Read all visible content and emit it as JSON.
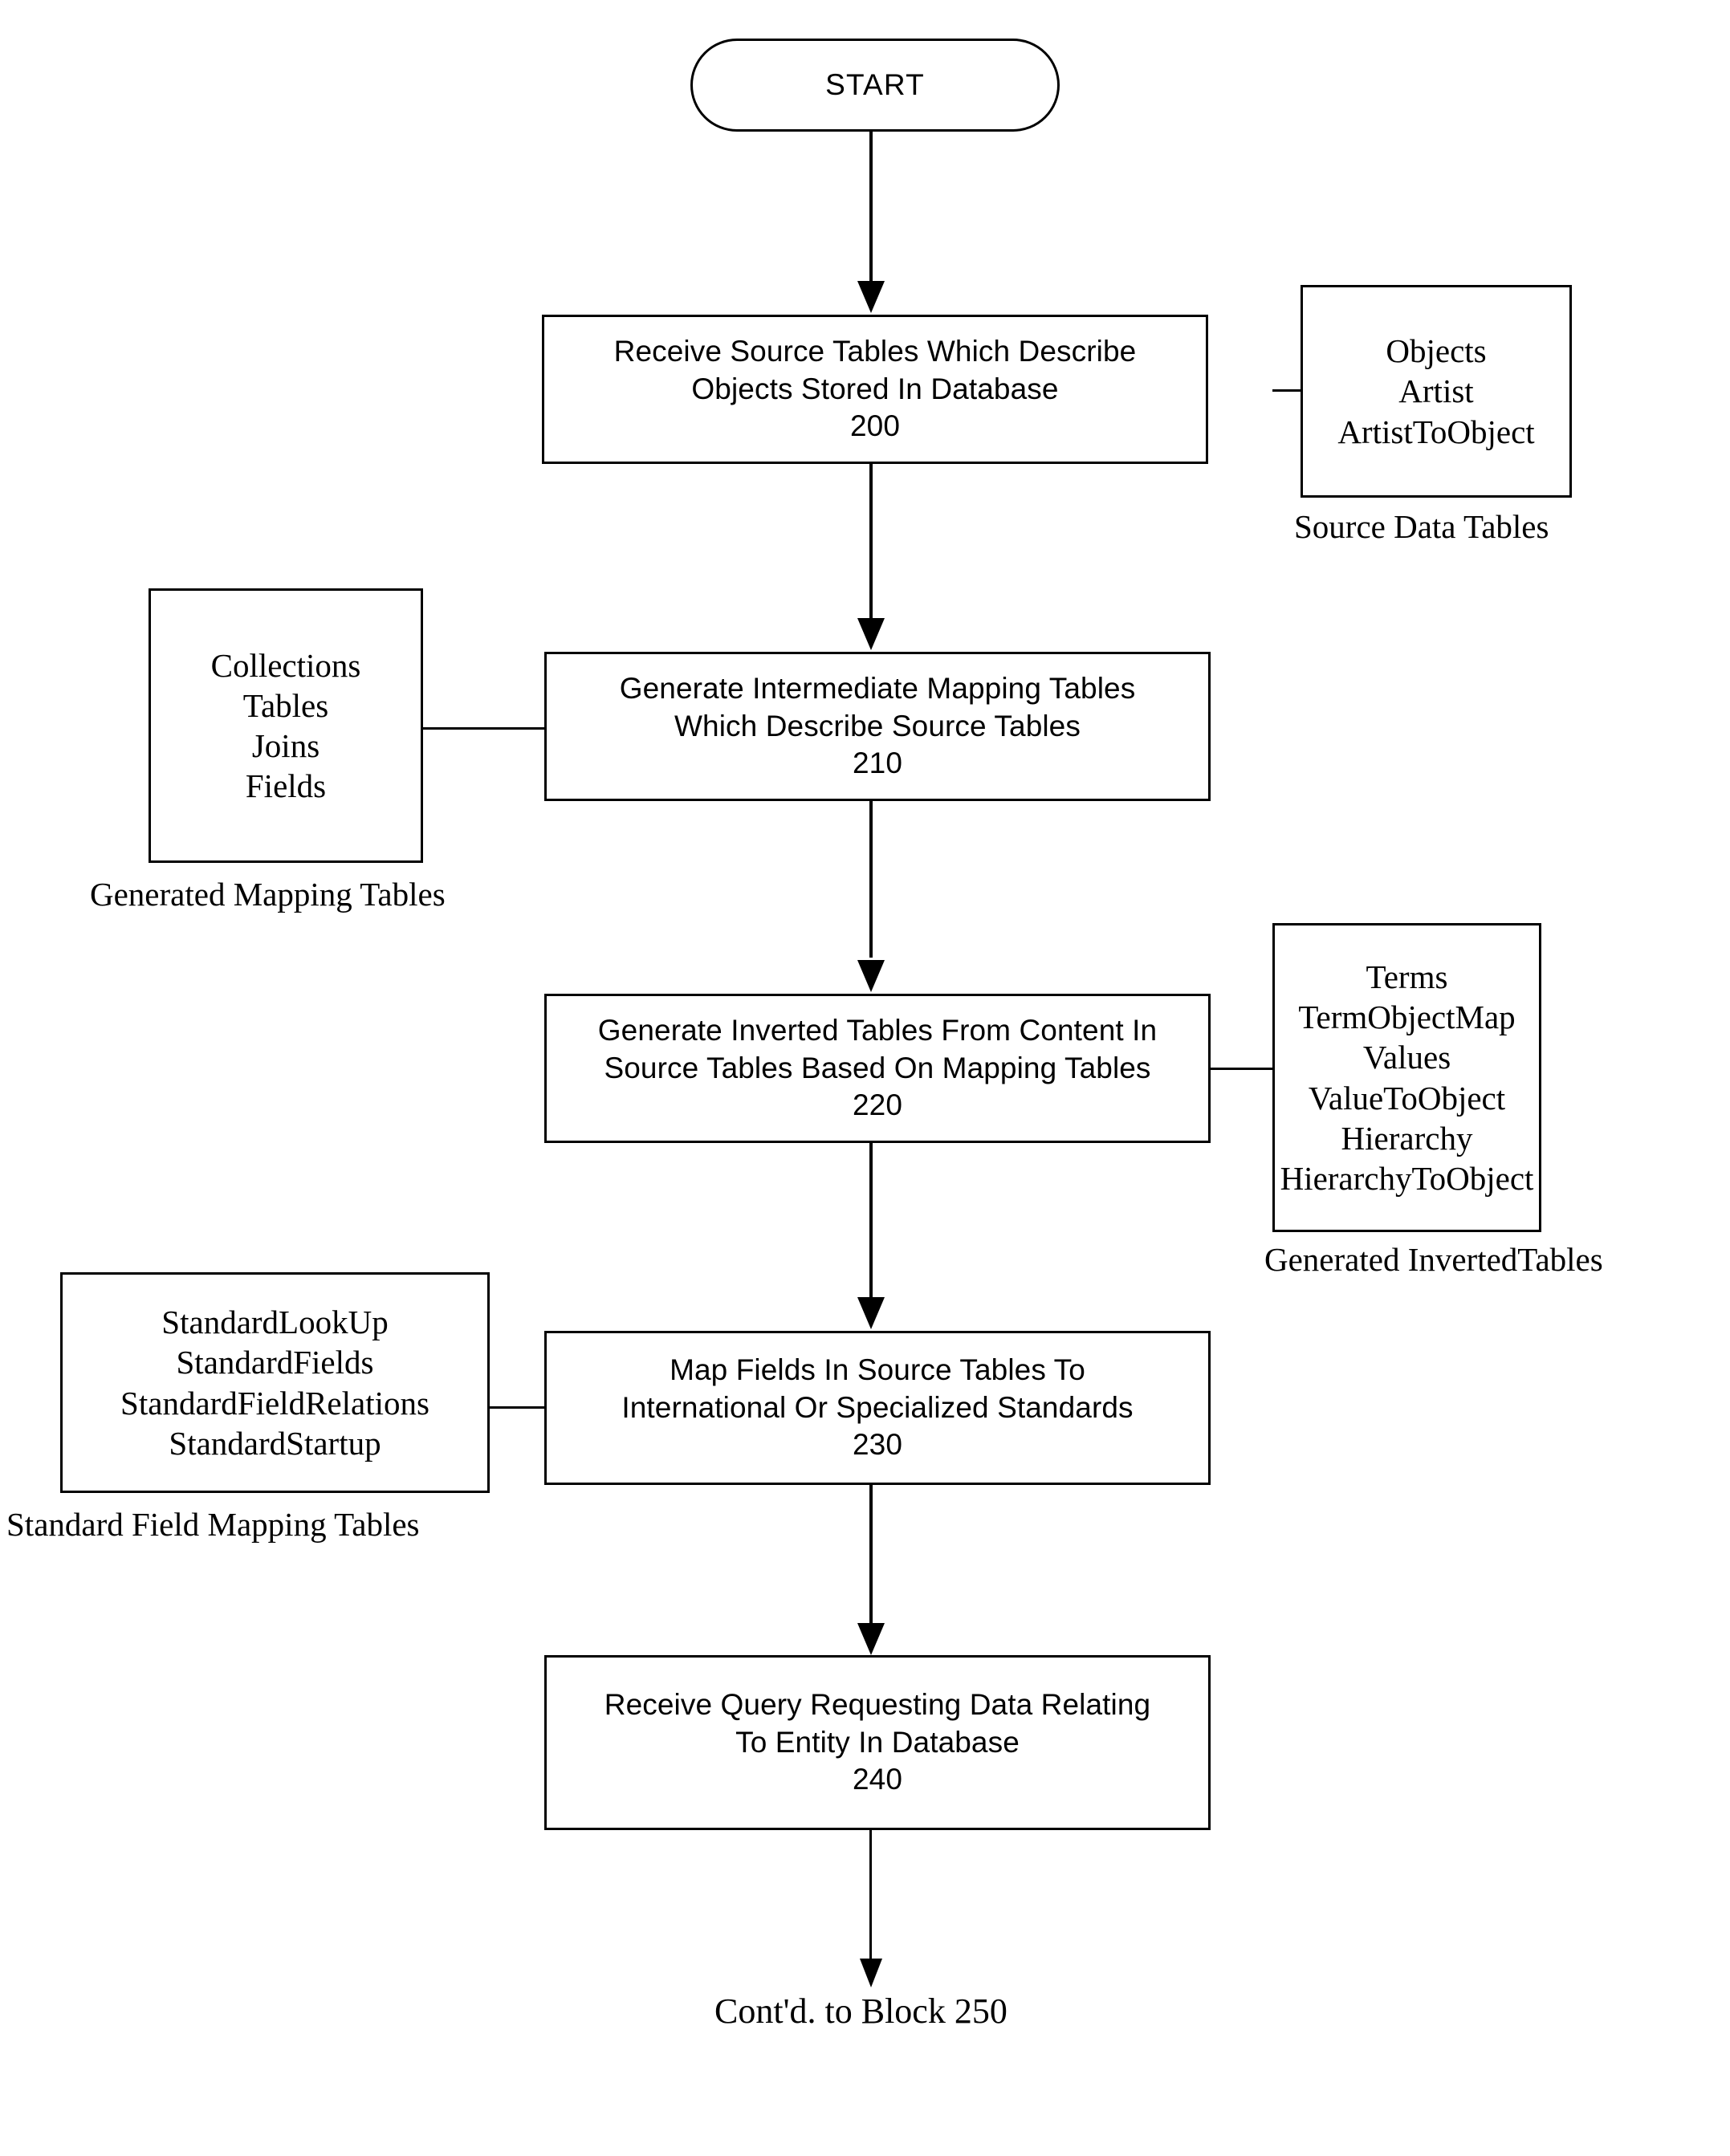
{
  "figure": {
    "start_label": "START",
    "continuation": "Cont'd. to Block 250"
  },
  "process_blocks": [
    {
      "id": "200",
      "line1": "Receive Source Tables Which Describe",
      "line2": "Objects Stored In Database",
      "number": "200"
    },
    {
      "id": "210",
      "line1": "Generate Intermediate Mapping Tables",
      "line2": "Which Describe Source Tables",
      "number": "210"
    },
    {
      "id": "220",
      "line1": "Generate Inverted Tables From Content In",
      "line2": "Source Tables Based On Mapping Tables",
      "number": "220"
    },
    {
      "id": "230",
      "line1": "Map Fields In Source Tables To",
      "line2": "International Or Specialized Standards",
      "number": "230"
    },
    {
      "id": "240",
      "line1": "Receive Query Requesting Data Relating",
      "line2": "To Entity In Database",
      "number": "240"
    }
  ],
  "side_boxes": {
    "source_data_tables": {
      "caption": "Source Data Tables",
      "items": [
        "Objects",
        "Artist",
        "ArtistToObject"
      ]
    },
    "generated_mapping_tables": {
      "caption": "Generated Mapping Tables",
      "items": [
        "Collections",
        "Tables",
        "Joins",
        "Fields"
      ]
    },
    "generated_inverted_tables": {
      "caption": "Generated InvertedTables",
      "items": [
        "Terms",
        "TermObjectMap",
        "Values",
        "ValueToObject",
        "Hierarchy",
        "HierarchyToObject"
      ]
    },
    "standard_field_mapping_tables": {
      "caption": "Standard Field Mapping Tables",
      "items": [
        "StandardLookUp",
        "StandardFields",
        "StandardFieldRelations",
        "StandardStartup"
      ]
    }
  },
  "colors": {
    "stroke": "#000000",
    "fill": "#ffffff"
  }
}
